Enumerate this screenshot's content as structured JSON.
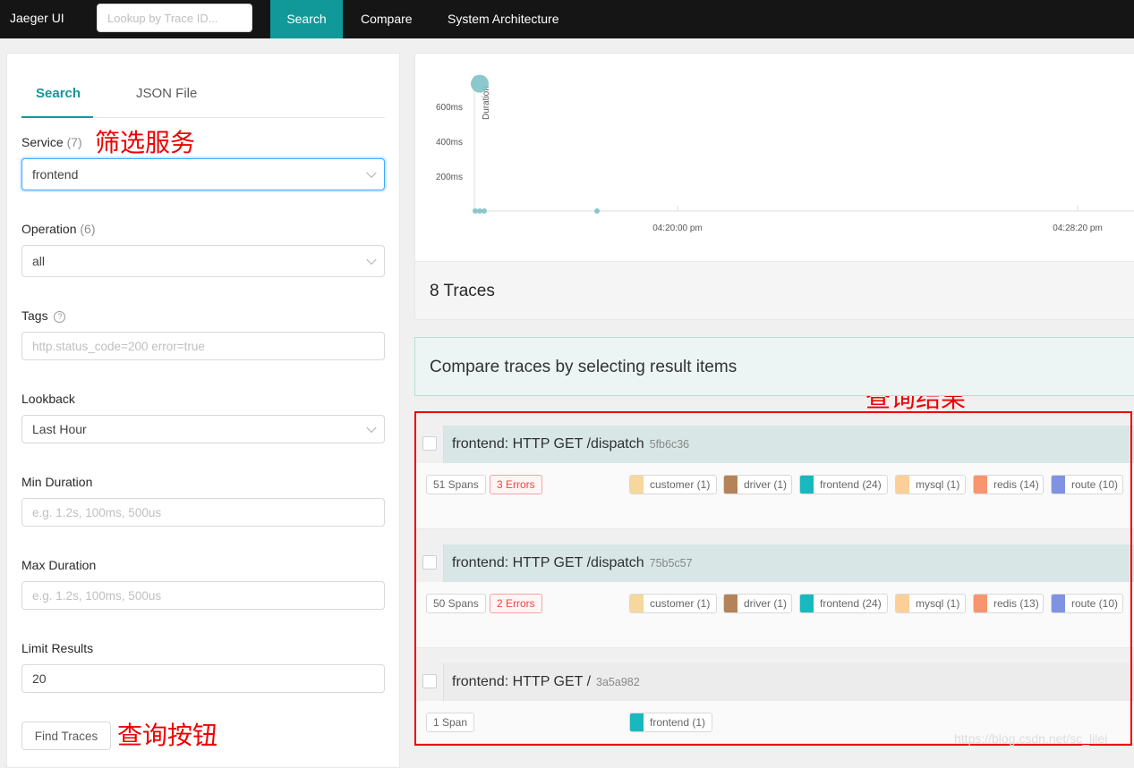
{
  "topbar": {
    "brand": "Jaeger UI",
    "lookup_placeholder": "Lookup by Trace ID...",
    "nav": {
      "search": "Search",
      "compare": "Compare",
      "arch": "System Architecture"
    }
  },
  "sidebar": {
    "tabs": {
      "search": "Search",
      "json": "JSON File"
    },
    "service": {
      "label": "Service",
      "count": "(7)",
      "value": "frontend"
    },
    "operation": {
      "label": "Operation",
      "count": "(6)",
      "value": "all"
    },
    "tags": {
      "label": "Tags",
      "help": "?",
      "placeholder": "http.status_code=200 error=true"
    },
    "lookback": {
      "label": "Lookback",
      "value": "Last Hour"
    },
    "min_duration": {
      "label": "Min Duration",
      "placeholder": "e.g. 1.2s, 100ms, 500us"
    },
    "max_duration": {
      "label": "Max Duration",
      "placeholder": "e.g. 1.2s, 100ms, 500us"
    },
    "limit": {
      "label": "Limit Results",
      "value": "20"
    },
    "find_button": "Find Traces"
  },
  "annotations": {
    "filter_service": "筛选服务",
    "query_results": "查询结果",
    "query_button": "查询按钮"
  },
  "chart_data": {
    "type": "scatter",
    "ylabel": "Duration",
    "y_ticks": [
      "600ms",
      "400ms",
      "200ms"
    ],
    "x_ticks": [
      "04:20:00 pm",
      "04:28:20 pm"
    ],
    "ylim_ms": [
      0,
      700
    ],
    "points": [
      {
        "x_label": "~04:16:30 pm",
        "duration_ms": 730,
        "size": "large"
      },
      {
        "x_label": "~04:16:30 pm",
        "duration_ms": 0,
        "size": "small"
      },
      {
        "x_label": "~04:16:31 pm",
        "duration_ms": 0,
        "size": "small"
      },
      {
        "x_label": "~04:16:32 pm",
        "duration_ms": 0,
        "size": "small"
      },
      {
        "x_label": "~04:17:50 pm",
        "duration_ms": 0,
        "size": "small"
      }
    ],
    "color": "#7fc2c7"
  },
  "results": {
    "count_label": "8 Traces",
    "compare_hint": "Compare traces by selecting result items",
    "traces": [
      {
        "title": "frontend: HTTP GET /dispatch",
        "id": "5fb6c36",
        "spans": "51 Spans",
        "errors": "3 Errors",
        "services": [
          {
            "name": "customer (1)",
            "color": "#f6d79d"
          },
          {
            "name": "driver (1)",
            "color": "#b5835a"
          },
          {
            "name": "frontend (24)",
            "color": "#17b8be"
          },
          {
            "name": "mysql (1)",
            "color": "#fccf98"
          },
          {
            "name": "redis (14)",
            "color": "#f89570"
          },
          {
            "name": "route (10)",
            "color": "#8093e0"
          }
        ]
      },
      {
        "title": "frontend: HTTP GET /dispatch",
        "id": "75b5c57",
        "spans": "50 Spans",
        "errors": "2 Errors",
        "services": [
          {
            "name": "customer (1)",
            "color": "#f6d79d"
          },
          {
            "name": "driver (1)",
            "color": "#b5835a"
          },
          {
            "name": "frontend (24)",
            "color": "#17b8be"
          },
          {
            "name": "mysql (1)",
            "color": "#fccf98"
          },
          {
            "name": "redis (13)",
            "color": "#f89570"
          },
          {
            "name": "route (10)",
            "color": "#8093e0"
          }
        ]
      },
      {
        "title": "frontend: HTTP GET /",
        "id": "3a5a982",
        "spans": "1 Span",
        "services": [
          {
            "name": "frontend (1)",
            "color": "#17b8be"
          }
        ]
      }
    ]
  },
  "watermark": "https://blog.csdn.net/sc_lilei"
}
